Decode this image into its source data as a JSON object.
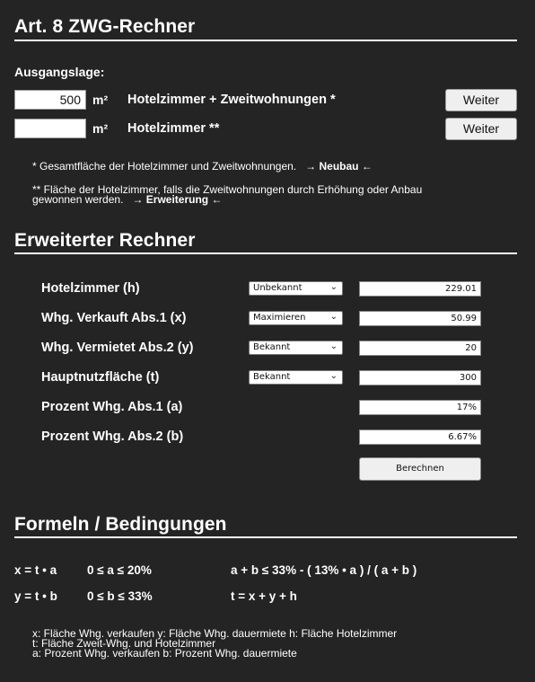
{
  "header": {
    "title": "Art. 8 ZWG-Rechner"
  },
  "ausgangslage": {
    "label": "Ausgangslage:",
    "row1": {
      "value": "500",
      "unit": "m²",
      "label": "Hotelzimmer + Zweitwohnungen *",
      "button": "Weiter"
    },
    "row2": {
      "value": "",
      "unit": "m²",
      "label": "Hotelzimmer **",
      "button": "Weiter"
    },
    "note1_text": "* Gesamtfläche der Hotelzimmer und Zweitwohnungen.",
    "note1_arrow_l": "→",
    "note1_link": "Neubau",
    "note1_arrow_r": "←",
    "note2_line1": "** Fläche der Hotelzimmer, falls die Zweitwohnungen durch Erhöhung oder Anbau",
    "note2_line2": "gewonnen werden.",
    "note2_arrow_l": "→",
    "note2_link": "Erweiterung",
    "note2_arrow_r": "←"
  },
  "rechner": {
    "title": "Erweiterter Rechner",
    "rows": [
      {
        "label": "Hotelzimmer (h)",
        "select": "Unbekannt",
        "value": "229.01"
      },
      {
        "label": "Whg. Verkauft Abs.1 (x)",
        "select": "Maximieren",
        "value": "50.99"
      },
      {
        "label": "Whg. Vermietet Abs.2 (y)",
        "select": "Bekannt",
        "value": "20"
      },
      {
        "label": "Hauptnutzfläche (t)",
        "select": "Bekannt",
        "value": "300"
      },
      {
        "label": "Prozent Whg. Abs.1 (a)",
        "value": "17%"
      },
      {
        "label": "Prozent Whg. Abs.2 (b)",
        "value": "6.67%"
      }
    ],
    "button": "Berechnen"
  },
  "formeln": {
    "title": "Formeln / Bedingungen",
    "f1": "x = t • a",
    "f2": "0 ≤ a ≤ 20%",
    "f3": "a + b ≤ 33% - ( 13% • a ) / ( a + b )",
    "f4": "y = t • b",
    "f5": "0 ≤ b ≤ 33%",
    "f6": "t = x + y + h",
    "legend1": "x: Fläche Whg. verkaufen   y: Fläche Whg. dauermiete   h: Fläche Hotelzimmer",
    "legend2": "t: Fläche Zweit-Whg. und Hotelzimmer",
    "legend3": "a: Prozent Whg. verkaufen   b: Prozent Whg. dauermiete"
  }
}
